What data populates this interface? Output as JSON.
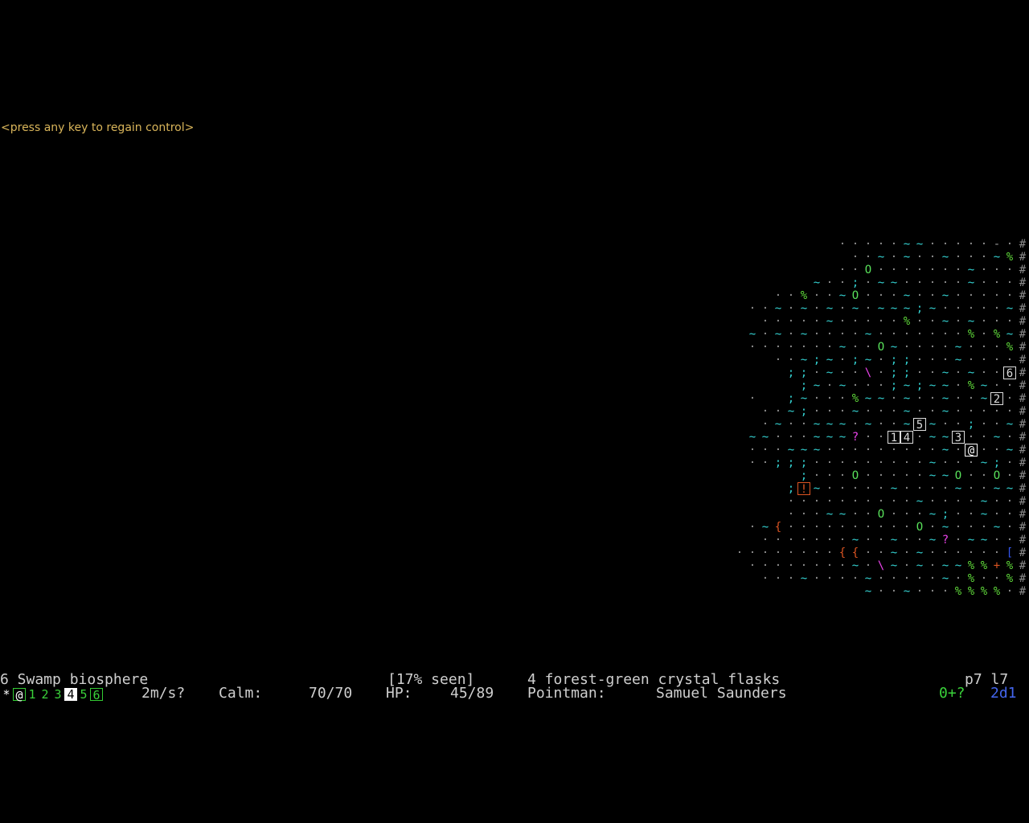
{
  "prompt": {
    "text": "<press any key to regain control>",
    "color": "#d9b55a"
  },
  "colors": {
    "floor": "#9a9a9a",
    "water": "#34d2d2",
    "plant": "#5fd83a",
    "tree": "#58e05a",
    "wall": "#8a8a8a",
    "player": "#ffffff",
    "ally": "#dddddd",
    "rune": "#ee44ee",
    "item_red": "#dd5522",
    "item_blue": "#3355ee",
    "status_text": "#cfcfcf",
    "status_green": "#3ad23a",
    "status_blue": "#4466ee"
  },
  "map": {
    "cols": 23,
    "rows": [
      "       ·····~~·····-·#",
      "       ··~·~··~···~%#",
      "       ··O·······~···#",
      "    ~··;·~~·····~···#",
      "  ··%··~O···~··~·····#",
      "··~·~·~·~·~~~;~·····~#",
      "·····~·····%··~·~···#",
      "~·~·~····~·······%·%~#",
      "·······~··O~····~···%#",
      "  ··~;~·;~·;;···~····#",
      "   ;;·~··\\·;;··~·~··6#",
      "   ;~·~···;~;~~·%~··#",
      "·  ;~···%~~·~··~··~2·#",
      "··~;···~···~··~·····#",
      "·~··~~~·~··~5~··;··~#",
      "~~···~~~?··14·~~3··~·#",
      "···~~~·········~·@··~#",
      "··;;;·········~···~;·#",
      "    ;···O·····~~O··O·#",
      "    ;!~·····~····~··~~#",
      "   ··········~····~··#",
      "  ···~~··O···~;··~··#",
      "·~{··········O·~···~·#",
      "·······~··~··~?·~~··#",
      "········{{··~·~······[#",
      "········~·\\~·~·~~%%+%#",
      "···~····~·····~·%··%#",
      "        ~··~···%%%%·#"
    ]
  },
  "status": {
    "line1_left": "6 Swamp biosphere",
    "line1_seen": "[17% seen]",
    "line1_item": "4 forest-green crystal flasks",
    "line1_pos": "p7 l7",
    "line2_speed": "2m/s?",
    "line2_calm_label": "Calm:",
    "line2_calm_value": "70/70",
    "line2_hp_label": "HP:",
    "line2_hp_value": "45/89",
    "line2_role": "Pointman:",
    "line2_name": "Samuel Saunders",
    "line2_code": "0+?",
    "line2_dice": "2d1"
  },
  "party": {
    "leader_glyph": "*",
    "slots": [
      "@",
      "1",
      "2",
      "3",
      "4",
      "5",
      "6"
    ],
    "selected_index": 4
  }
}
